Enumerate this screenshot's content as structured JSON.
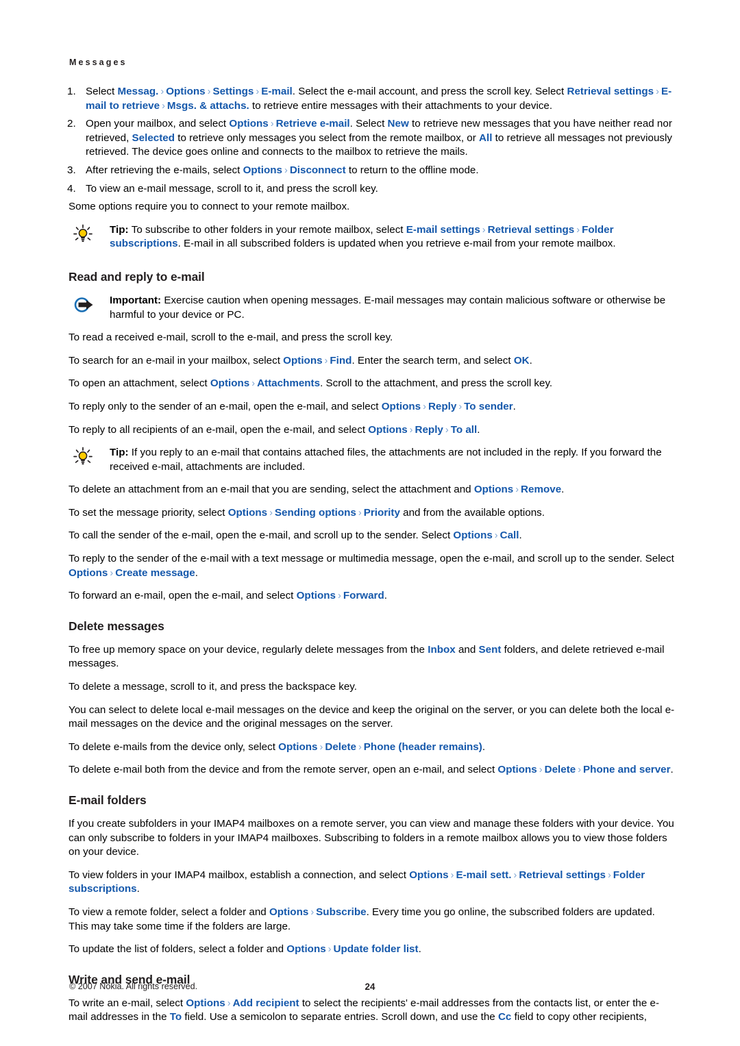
{
  "document": {
    "running_head": "Messages",
    "page_number": "24",
    "copyright": "© 2007 Nokia. All rights reserved.",
    "accent_color": "#1558ab",
    "separator_color": "#7fa6d4",
    "separator_glyph": "›"
  },
  "steps": [
    {
      "number": "1.",
      "parts": [
        {
          "t": "Select "
        },
        {
          "t": "Messag.",
          "ui": true
        },
        {
          "t": "›",
          "sep": true
        },
        {
          "t": "Options",
          "ui": true
        },
        {
          "t": "›",
          "sep": true
        },
        {
          "t": "Settings",
          "ui": true
        },
        {
          "t": "›",
          "sep": true
        },
        {
          "t": "E-mail",
          "ui": true
        },
        {
          "t": ". Select the e-mail account, and press the scroll key. Select "
        },
        {
          "t": "Retrieval settings",
          "ui": true
        },
        {
          "t": "›",
          "sep": true
        },
        {
          "t": "E-mail to retrieve",
          "ui": true
        },
        {
          "t": "›",
          "sep": true
        },
        {
          "t": "Msgs. & attachs.",
          "ui": true
        },
        {
          "t": " to retrieve entire messages with their attachments to your device."
        }
      ]
    },
    {
      "number": "2.",
      "parts": [
        {
          "t": "Open your mailbox, and select "
        },
        {
          "t": "Options",
          "ui": true
        },
        {
          "t": "›",
          "sep": true
        },
        {
          "t": "Retrieve e-mail",
          "ui": true
        },
        {
          "t": ". Select "
        },
        {
          "t": "New",
          "ui": true
        },
        {
          "t": " to retrieve new messages that you have neither read nor retrieved, "
        },
        {
          "t": "Selected",
          "ui": true
        },
        {
          "t": " to retrieve only messages you select from the remote mailbox, or "
        },
        {
          "t": "All",
          "ui": true
        },
        {
          "t": " to retrieve all messages not previously retrieved. The device goes online and connects to the mailbox to retrieve the mails."
        }
      ]
    },
    {
      "number": "3.",
      "parts": [
        {
          "t": "After retrieving the e-mails, select "
        },
        {
          "t": "Options",
          "ui": true
        },
        {
          "t": "›",
          "sep": true
        },
        {
          "t": "Disconnect",
          "ui": true
        },
        {
          "t": " to return to the offline mode."
        }
      ]
    },
    {
      "number": "4.",
      "parts": [
        {
          "t": "To view an e-mail message, scroll to it, and press the scroll key."
        }
      ]
    }
  ],
  "after_steps_para": [
    {
      "t": "Some options require you to connect to your remote mailbox."
    }
  ],
  "tip_subscribe": {
    "icon": "lightbulb-tip-icon",
    "parts": [
      {
        "t": "Tip: ",
        "bold": true
      },
      {
        "t": "To subscribe to other folders in your remote mailbox, select "
      },
      {
        "t": "E-mail settings",
        "ui": true
      },
      {
        "t": "›",
        "sep": true
      },
      {
        "t": "Retrieval settings",
        "ui": true
      },
      {
        "t": "›",
        "sep": true
      },
      {
        "t": "Folder subscriptions",
        "ui": true
      },
      {
        "t": ". E-mail in all subscribed folders is updated when you retrieve e-mail from your remote mailbox."
      }
    ]
  },
  "sections": [
    {
      "id": "read-and-reply",
      "heading": "Read and reply to e-mail"
    },
    {
      "id": "delete-messages",
      "heading": "Delete messages"
    },
    {
      "id": "email-folders",
      "heading": "E-mail folders"
    },
    {
      "id": "write-and-send",
      "heading": "Write and send e-mail"
    }
  ],
  "important_note": {
    "icon": "important-arrow-icon",
    "parts": [
      {
        "t": "Important:",
        "bold": true
      },
      {
        "t": "  Exercise caution when opening messages. E-mail messages may contain malicious software or otherwise be harmful to your device or PC."
      }
    ]
  },
  "read_reply_paras": [
    [
      {
        "t": "To read a received e-mail, scroll to the e-mail, and press the scroll key."
      }
    ],
    [
      {
        "t": "To search for an e-mail in your mailbox, select "
      },
      {
        "t": "Options",
        "ui": true
      },
      {
        "t": "›",
        "sep": true
      },
      {
        "t": "Find",
        "ui": true
      },
      {
        "t": ". Enter the search term, and select "
      },
      {
        "t": "OK",
        "ui": true
      },
      {
        "t": "."
      }
    ],
    [
      {
        "t": "To open an attachment, select "
      },
      {
        "t": "Options",
        "ui": true
      },
      {
        "t": "›",
        "sep": true
      },
      {
        "t": "Attachments",
        "ui": true
      },
      {
        "t": ". Scroll to the attachment, and press the scroll key."
      }
    ],
    [
      {
        "t": "To reply only to the sender of an e-mail, open the e-mail, and select "
      },
      {
        "t": "Options",
        "ui": true
      },
      {
        "t": "›",
        "sep": true
      },
      {
        "t": "Reply",
        "ui": true
      },
      {
        "t": "›",
        "sep": true
      },
      {
        "t": "To sender",
        "ui": true
      },
      {
        "t": "."
      }
    ],
    [
      {
        "t": "To reply to all recipients of an e-mail, open the e-mail, and select "
      },
      {
        "t": "Options",
        "ui": true
      },
      {
        "t": "›",
        "sep": true
      },
      {
        "t": "Reply",
        "ui": true
      },
      {
        "t": "›",
        "sep": true
      },
      {
        "t": "To all",
        "ui": true
      },
      {
        "t": "."
      }
    ]
  ],
  "tip_reply": {
    "icon": "lightbulb-tip-icon",
    "parts": [
      {
        "t": "Tip: ",
        "bold": true
      },
      {
        "t": "If you reply to an e-mail that contains attached files, the attachments are not included in the reply. If you forward the received e-mail, attachments are included."
      }
    ]
  },
  "read_reply_paras_2": [
    [
      {
        "t": "To delete an attachment from an e-mail that you are sending, select the attachment and "
      },
      {
        "t": "Options",
        "ui": true
      },
      {
        "t": "›",
        "sep": true
      },
      {
        "t": "Remove",
        "ui": true
      },
      {
        "t": "."
      }
    ],
    [
      {
        "t": "To set the message priority, select "
      },
      {
        "t": "Options",
        "ui": true
      },
      {
        "t": "›",
        "sep": true
      },
      {
        "t": "Sending options",
        "ui": true
      },
      {
        "t": "›",
        "sep": true
      },
      {
        "t": "Priority",
        "ui": true
      },
      {
        "t": " and from the available options."
      }
    ],
    [
      {
        "t": "To call the sender of the e-mail, open the e-mail, and scroll up to the sender. Select "
      },
      {
        "t": "Options",
        "ui": true
      },
      {
        "t": "›",
        "sep": true
      },
      {
        "t": "Call",
        "ui": true
      },
      {
        "t": "."
      }
    ],
    [
      {
        "t": "To reply to the sender of the e-mail with a text message or multimedia message, open the e-mail, and scroll up to the sender. Select "
      },
      {
        "t": "Options",
        "ui": true
      },
      {
        "t": "›",
        "sep": true
      },
      {
        "t": "Create message",
        "ui": true
      },
      {
        "t": "."
      }
    ],
    [
      {
        "t": "To forward an e-mail, open the e-mail, and select "
      },
      {
        "t": "Options",
        "ui": true
      },
      {
        "t": "›",
        "sep": true
      },
      {
        "t": "Forward",
        "ui": true
      },
      {
        "t": "."
      }
    ]
  ],
  "delete_messages_paras": [
    [
      {
        "t": "To free up memory space on your device, regularly delete messages from the "
      },
      {
        "t": "Inbox",
        "ui": true
      },
      {
        "t": " and "
      },
      {
        "t": "Sent",
        "ui": true
      },
      {
        "t": " folders, and delete retrieved e-mail messages."
      }
    ],
    [
      {
        "t": "To delete a message, scroll to it, and press the backspace key."
      }
    ],
    [
      {
        "t": "You can select to delete local e-mail messages on the device and keep the original on the server, or you can delete both the local e-mail messages on the device and the original messages on the server."
      }
    ],
    [
      {
        "t": "To delete e-mails from the device only, select "
      },
      {
        "t": "Options",
        "ui": true
      },
      {
        "t": "›",
        "sep": true
      },
      {
        "t": "Delete",
        "ui": true
      },
      {
        "t": "›",
        "sep": true
      },
      {
        "t": "Phone (header remains)",
        "ui": true
      },
      {
        "t": "."
      }
    ],
    [
      {
        "t": "To delete e-mail both from the device and from the remote server, open an e-mail, and select "
      },
      {
        "t": "Options",
        "ui": true
      },
      {
        "t": "›",
        "sep": true
      },
      {
        "t": "Delete",
        "ui": true
      },
      {
        "t": "›",
        "sep": true
      },
      {
        "t": "Phone and server",
        "ui": true
      },
      {
        "t": "."
      }
    ]
  ],
  "email_folders_paras": [
    [
      {
        "t": "If you create subfolders in your IMAP4 mailboxes on a remote server, you can view and manage these folders with your device. You can only subscribe to folders in your IMAP4 mailboxes. Subscribing to folders in a remote mailbox allows you to view those folders on your device."
      }
    ],
    [
      {
        "t": "To view folders in your IMAP4 mailbox, establish a connection, and select "
      },
      {
        "t": "Options",
        "ui": true
      },
      {
        "t": "›",
        "sep": true
      },
      {
        "t": "E-mail sett.",
        "ui": true
      },
      {
        "t": "›",
        "sep": true
      },
      {
        "t": "Retrieval settings",
        "ui": true
      },
      {
        "t": "›",
        "sep": true
      },
      {
        "t": "Folder subscriptions",
        "ui": true
      },
      {
        "t": "."
      }
    ],
    [
      {
        "t": "To view a remote folder, select a folder and "
      },
      {
        "t": "Options",
        "ui": true
      },
      {
        "t": "›",
        "sep": true
      },
      {
        "t": "Subscribe",
        "ui": true
      },
      {
        "t": ". Every time you go online, the subscribed folders are updated. This may take some time if the folders are large."
      }
    ],
    [
      {
        "t": "To update the list of folders, select a folder and "
      },
      {
        "t": "Options",
        "ui": true
      },
      {
        "t": "›",
        "sep": true
      },
      {
        "t": "Update folder list",
        "ui": true
      },
      {
        "t": "."
      }
    ]
  ],
  "write_send_paras": [
    [
      {
        "t": "To write an e-mail, select "
      },
      {
        "t": "Options",
        "ui": true
      },
      {
        "t": "›",
        "sep": true
      },
      {
        "t": "Add recipient",
        "ui": true
      },
      {
        "t": " to select the recipients' e-mail addresses from the contacts list, or enter the e-mail addresses in the "
      },
      {
        "t": "To",
        "ui": true
      },
      {
        "t": " field. Use a semicolon to separate entries. Scroll down, and use the "
      },
      {
        "t": "Cc",
        "ui": true
      },
      {
        "t": " field to copy other recipients,"
      }
    ]
  ]
}
